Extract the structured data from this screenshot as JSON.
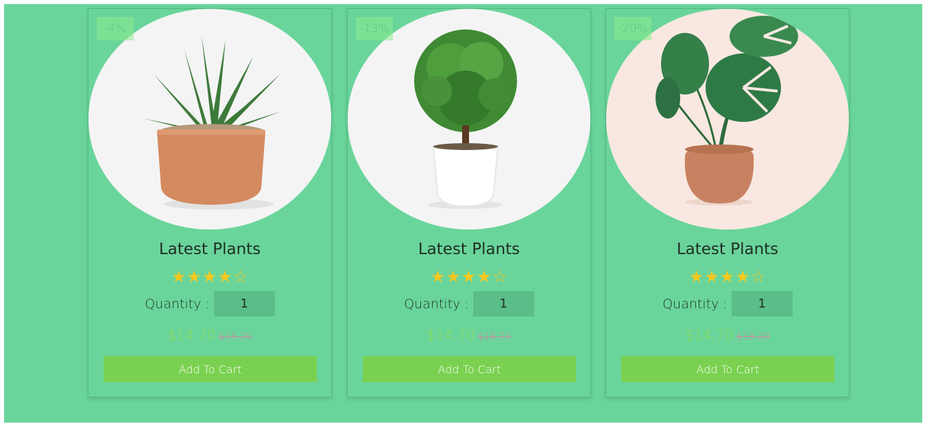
{
  "products": [
    {
      "badge": "-4%",
      "title": "Latest Plants",
      "rating": 4,
      "stars": [
        "★",
        "★",
        "★",
        "★",
        "☆"
      ],
      "quantity_label": "Quantity :",
      "quantity_value": "1",
      "price": "$14.70",
      "old_price": "$18.20",
      "button_label": "Add To Cart",
      "image": "succulent-in-terracotta-pot"
    },
    {
      "badge": "-13%",
      "title": "Latest Plants",
      "rating": 4,
      "stars": [
        "★",
        "★",
        "★",
        "★",
        "☆"
      ],
      "quantity_label": "Quantity :",
      "quantity_value": "1",
      "price": "$14.70",
      "old_price": "$18.20",
      "button_label": "Add To Cart",
      "image": "topiary-in-white-pot"
    },
    {
      "badge": "-20%",
      "title": "Latest Plants",
      "rating": 4,
      "stars": [
        "★",
        "★",
        "★",
        "★",
        "☆"
      ],
      "quantity_label": "Quantity :",
      "quantity_value": "1",
      "price": "$14.70",
      "old_price": "$18.20",
      "button_label": "Add To Cart",
      "image": "monstera-in-clay-pot"
    }
  ],
  "colors": {
    "background": "#6ad59b",
    "button": "#7ad150",
    "price": "#8fdc5a",
    "old_price": "#c98aa8",
    "star": "#f7c81e"
  }
}
